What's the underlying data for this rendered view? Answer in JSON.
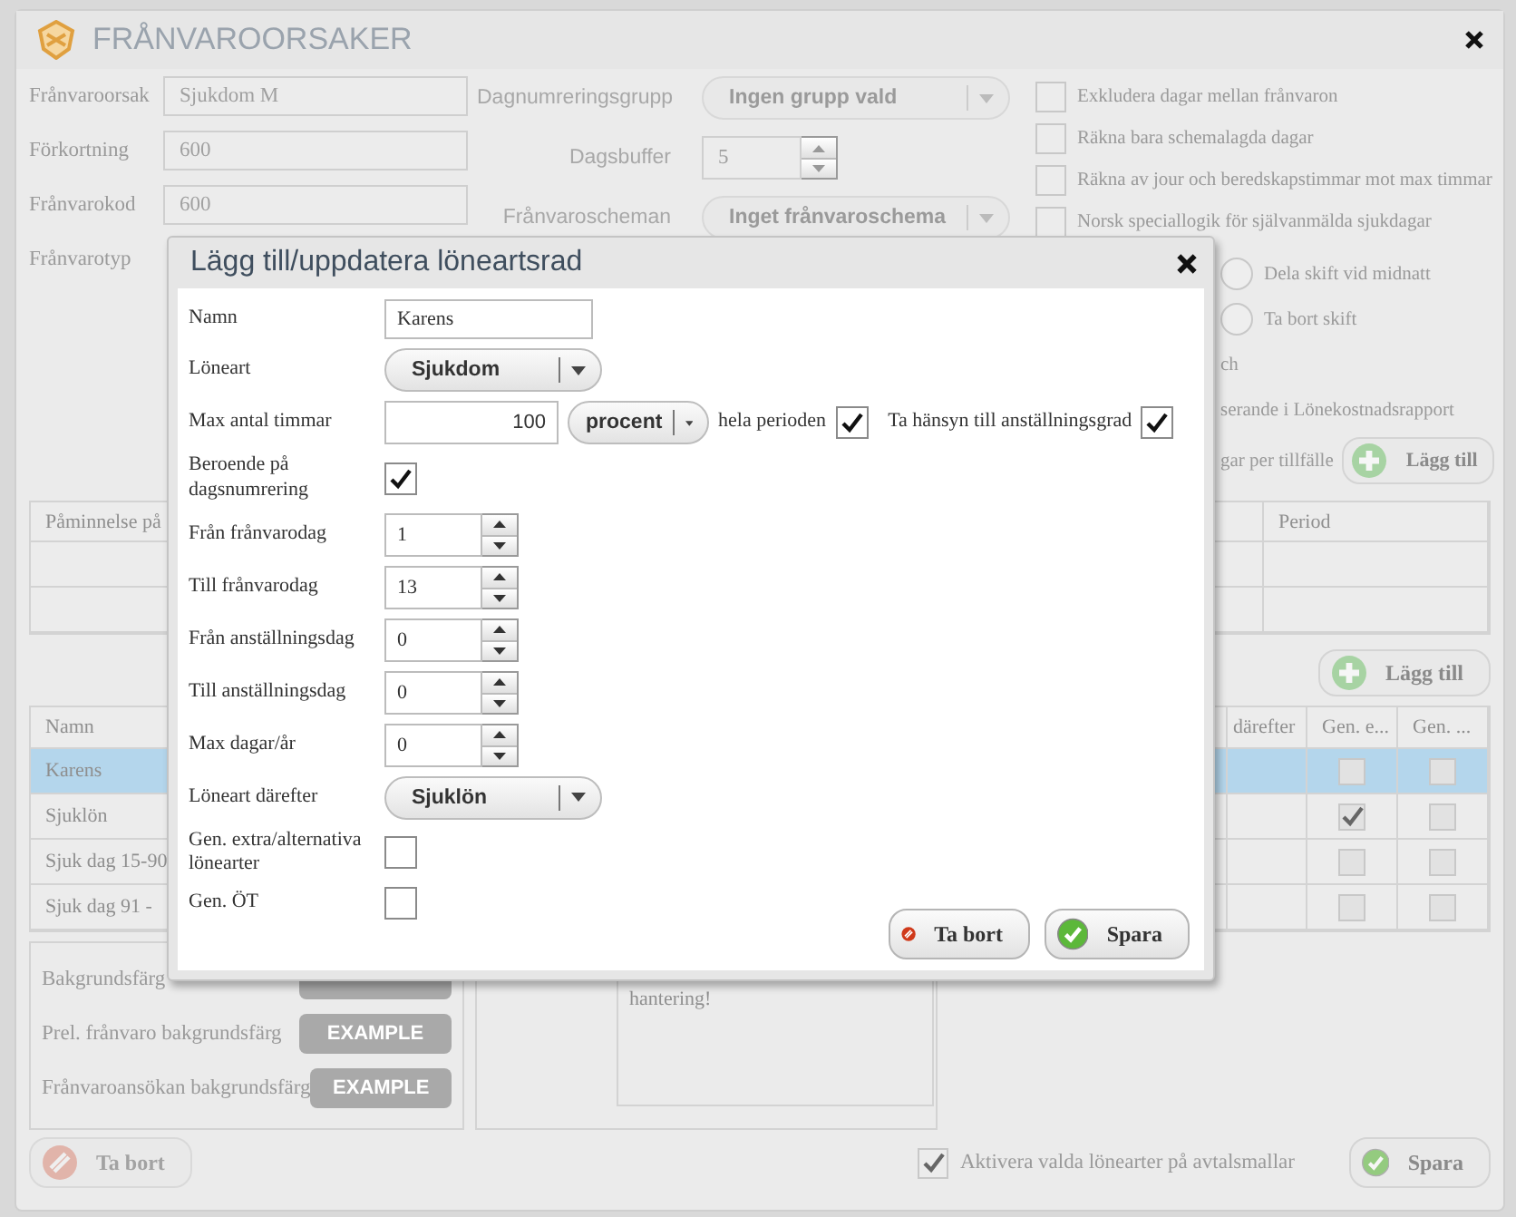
{
  "window": {
    "title": "FRÅNVAROORSAKER"
  },
  "fields": [
    {
      "kind": "text",
      "label": "Frånvaroorsak",
      "value": "Sjukdom M"
    },
    {
      "kind": "text",
      "label": "Förkortning",
      "value": "600"
    },
    {
      "kind": "text",
      "label": "Frånvarokod",
      "value": "600"
    },
    {
      "kind": "label",
      "label": "Frånvarotyp"
    }
  ],
  "middle_fields": [
    {
      "kind": "select",
      "label": "Dagnumreringsgrupp",
      "value": "Ingen grupp vald"
    },
    {
      "kind": "spinner",
      "label": "Dagsbuffer",
      "value": "5"
    },
    {
      "kind": "select",
      "label": "Frånvaroscheman",
      "value": "Inget frånvaroschema"
    }
  ],
  "options": [
    {
      "label": "Exkludera dagar mellan frånvaron",
      "checked": false
    },
    {
      "label": "Räkna bara schemalagda dagar",
      "checked": false
    },
    {
      "label": "Räkna av jour och beredskapstimmar mot max timmar",
      "checked": false
    },
    {
      "label": "Norsk speciallogik för självanmälda sjukdagar",
      "checked": false
    }
  ],
  "options_partial": [
    {
      "kind": "radio",
      "label": "Dela skift vid midnatt",
      "selected": false
    },
    {
      "kind": "radio",
      "label": "Ta bort skift",
      "selected": false
    },
    {
      "kind": "text",
      "label": "ch"
    },
    {
      "kind": "text",
      "label": "serande i Lönekostnadsrapport"
    },
    {
      "kind": "add",
      "label": "gar per tillfälle",
      "button": "Lägg till"
    }
  ],
  "reminder_table": {
    "columns": [
      "Påminnelse på",
      "Period"
    ]
  },
  "add_button": "Lägg till",
  "wage_table": {
    "columns": [
      "Namn",
      "därefter",
      "Gen. e...",
      "Gen. ..."
    ],
    "rows": [
      {
        "name": "Karens",
        "selected": true,
        "gen_extra": false,
        "gen_ot": false
      },
      {
        "name": "Sjuklön",
        "selected": false,
        "gen_extra": true,
        "gen_ot": false
      },
      {
        "name": "Sjuk dag 15-90",
        "selected": false,
        "gen_extra": false,
        "gen_ot": false
      },
      {
        "name": "Sjuk dag 91 -",
        "selected": false,
        "gen_extra": false,
        "gen_ot": false
      }
    ]
  },
  "colors": [
    {
      "label": "Bakgrundsfärg"
    },
    {
      "label": "Prel. frånvaro bakgrundsfärg",
      "sample": "EXAMPLE"
    },
    {
      "label": "Frånvaroansökan bakgrundsfärg",
      "sample": "EXAMPLE"
    }
  ],
  "note": "hantering!",
  "footer": {
    "delete": "Ta bort",
    "delete_disabled": true,
    "activate_label": "Aktivera valda lönearter på avtalsmallar",
    "activate_checked": true,
    "save": "Spara"
  },
  "dialog": {
    "title": "Lägg till/uppdatera löneartsrad",
    "rows": [
      {
        "kind": "text",
        "label": "Namn",
        "value": "Karens"
      },
      {
        "kind": "select",
        "label": "Löneart",
        "value": "Sjukdom"
      },
      {
        "kind": "amount",
        "label": "Max antal timmar",
        "value": "100",
        "unit": "procent",
        "period_label": "hela perioden",
        "period_checked": true,
        "grade_label": "Ta hänsyn till anställningsgrad",
        "grade_checked": true
      },
      {
        "kind": "check",
        "label": "Beroende på dagsnumrering",
        "checked": true
      },
      {
        "kind": "spinner",
        "label": "Från frånvarodag",
        "value": "1"
      },
      {
        "kind": "spinner",
        "label": "Till frånvarodag",
        "value": "13"
      },
      {
        "kind": "spinner",
        "label": "Från anställningsdag",
        "value": "0"
      },
      {
        "kind": "spinner",
        "label": "Till anställningsdag",
        "value": "0"
      },
      {
        "kind": "spinner",
        "label": "Max dagar/år",
        "value": "0"
      },
      {
        "kind": "select",
        "label": "Löneart därefter",
        "value": "Sjuklön"
      },
      {
        "kind": "check",
        "label": "Gen. extra/alternativa lönearter",
        "checked": false
      },
      {
        "kind": "check",
        "label": "Gen. ÖT",
        "checked": false
      }
    ],
    "buttons": [
      {
        "kind": "delete",
        "label": "Ta bort"
      },
      {
        "kind": "save",
        "label": "Spara"
      }
    ]
  }
}
